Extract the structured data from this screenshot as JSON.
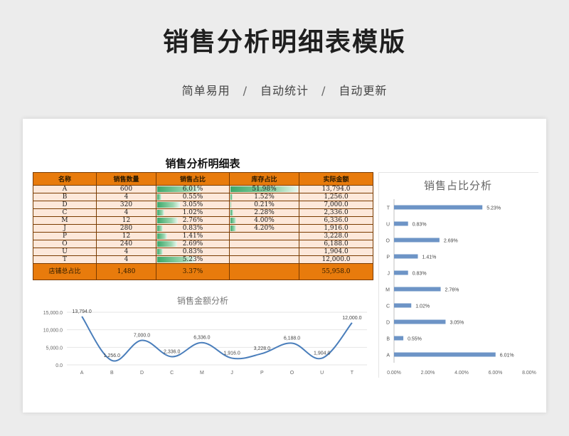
{
  "header": {
    "title": "销售分析明细表模版",
    "features": [
      "简单易用",
      "自动统计",
      "自动更新"
    ],
    "separator": "/"
  },
  "sheet": {
    "title": "销售分析明细表",
    "columns": [
      "名称",
      "销售数量",
      "销售占比",
      "库存占比",
      "实际金额"
    ],
    "rows": [
      {
        "name": "A",
        "qty": "600",
        "sales_pct": "6.01%",
        "stock_pct": "51.98%",
        "amount": "13,794.0"
      },
      {
        "name": "B",
        "qty": "4",
        "sales_pct": "0.55%",
        "stock_pct": "1.52%",
        "amount": "1,256.0"
      },
      {
        "name": "D",
        "qty": "320",
        "sales_pct": "3.05%",
        "stock_pct": "0.21%",
        "amount": "7,000.0"
      },
      {
        "name": "C",
        "qty": "4",
        "sales_pct": "1.02%",
        "stock_pct": "2.28%",
        "amount": "2,336.0"
      },
      {
        "name": "M",
        "qty": "12",
        "sales_pct": "2.76%",
        "stock_pct": "4.00%",
        "amount": "6,336.0"
      },
      {
        "name": "J",
        "qty": "280",
        "sales_pct": "0.83%",
        "stock_pct": "4.20%",
        "amount": "1,916.0"
      },
      {
        "name": "P",
        "qty": "12",
        "sales_pct": "1.41%",
        "stock_pct": "",
        "amount": "3,228.0"
      },
      {
        "name": "O",
        "qty": "240",
        "sales_pct": "2.69%",
        "stock_pct": "",
        "amount": "6,188.0"
      },
      {
        "name": "U",
        "qty": "4",
        "sales_pct": "0.83%",
        "stock_pct": "",
        "amount": "1,904.0"
      },
      {
        "name": "T",
        "qty": "4",
        "sales_pct": "5.23%",
        "stock_pct": "",
        "amount": "12,000.0"
      }
    ],
    "total": {
      "name": "店铺总占比",
      "qty": "1,480",
      "sales_pct": "3.37%",
      "stock_pct": "",
      "amount": "55,958.0"
    },
    "sales_bar_fraction": [
      0.6,
      0.06,
      0.31,
      0.1,
      0.28,
      0.08,
      0.14,
      0.27,
      0.08,
      0.52
    ],
    "stock_bar_fraction": [
      0.98,
      0.03,
      0.01,
      0.04,
      0.08,
      0.08
    ]
  },
  "chart_data": [
    {
      "type": "line",
      "title": "销售金额分析",
      "categories": [
        "A",
        "B",
        "D",
        "C",
        "M",
        "J",
        "P",
        "O",
        "U",
        "T"
      ],
      "values": [
        13794,
        1256,
        7000,
        2336,
        6336,
        1916,
        3228,
        6188,
        1904,
        12000
      ],
      "data_labels": [
        "13,794.0",
        "1,256.0",
        "7,000.0",
        "2,336.0",
        "6,336.0",
        "1,916.0",
        "3,228.0",
        "6,188.0",
        "1,904.0",
        "12,000.0"
      ],
      "yticks": [
        "0.0",
        "5,000.0",
        "10,000.0",
        "15,000.0"
      ],
      "ylim": [
        0,
        15000
      ],
      "color": "#4a7ebb"
    },
    {
      "type": "bar",
      "orientation": "horizontal",
      "title": "销售占比分析",
      "categories": [
        "T",
        "U",
        "O",
        "P",
        "J",
        "M",
        "C",
        "D",
        "B",
        "A"
      ],
      "values": [
        5.23,
        0.83,
        2.69,
        1.41,
        0.83,
        2.76,
        1.02,
        3.05,
        0.55,
        6.01
      ],
      "data_labels": [
        "5.23%",
        "0.83%",
        "2.69%",
        "1.41%",
        "0.83%",
        "2.76%",
        "1.02%",
        "3.05%",
        "0.55%",
        "6.01%"
      ],
      "xticks": [
        "0.00%",
        "2.00%",
        "4.00%",
        "6.00%",
        "8.00%"
      ],
      "xlim": [
        0,
        8
      ],
      "color": "#6d94c6"
    }
  ]
}
